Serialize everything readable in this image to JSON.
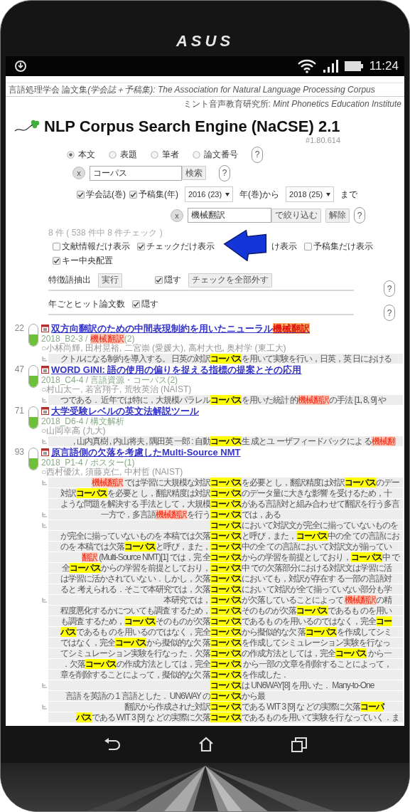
{
  "phone": {
    "brand": "ASUS"
  },
  "status_bar": {
    "time": "11:24"
  },
  "header": {
    "site_name": "言語処理学会 論文集",
    "site_subtitle": "(学会誌＋予稿集): The Association for Natural Language Processing Corpus",
    "institute_line": "ミント音声教育研究所: *Mint Phonetics Education Institute*",
    "title": "NLP Corpus Search Engine (NaCSE) 2.1",
    "version": "#1.80.614"
  },
  "search": {
    "fields": [
      {
        "label": "本文",
        "selected": true
      },
      {
        "label": "表題",
        "selected": false
      },
      {
        "label": "筆者",
        "selected": false
      },
      {
        "label": "論文番号",
        "selected": false
      }
    ],
    "fields_help": "?",
    "clear": "x",
    "query": "コーパス",
    "search_button": "検索",
    "query_help": "?"
  },
  "range": {
    "sources": [
      {
        "label": "学会誌(巻)",
        "checked": true
      },
      {
        "label": "予稿集(年)",
        "checked": true
      }
    ],
    "from": "2016 (23)",
    "from_suffix": "年(巻)から",
    "to": "2018 (25)",
    "to_suffix": "まで"
  },
  "filter": {
    "clear": "x",
    "value": "機械翻訳",
    "apply_button": "で絞り込む",
    "reset_button": "解除",
    "help": "?"
  },
  "count": "8 件 ( 538 件中 8 件チェック )",
  "options": [
    {
      "label": "文献情報だけ表示",
      "checked": false
    },
    {
      "label": "チェックだけ表示",
      "checked": true
    },
    {
      "label": "予稿集だけ表示",
      "checked": false
    },
    {
      "label": "キー中央配置",
      "checked": true
    }
  ],
  "covered_option_text": "け表示",
  "features": {
    "label": "特徴語抽出",
    "run_button": "実行",
    "hide": {
      "label": "隠す",
      "checked": true
    },
    "uncheck_button": "チェックを全部外す",
    "help": "?"
  },
  "yearly": {
    "label": "年ごとヒット論文数",
    "hide": {
      "label": "隠す",
      "checked": true
    },
    "help": "?"
  },
  "results": [
    {
      "rank": "22",
      "on": true,
      "title": [
        {
          "kind": "text",
          "text": "双方向翻訳のための中間表現制約を用いたニューラル"
        },
        {
          "kind": "mt",
          "text": "機械翻訳"
        }
      ],
      "meta": [
        {
          "kind": "text",
          "text": "2018_B2-3 / "
        },
        {
          "kind": "mt",
          "text": "機械翻訳"
        },
        {
          "kind": "text",
          "text": "(2)"
        }
      ],
      "authors": "○小林尚輝, 田村晃裕, 二宮崇 (愛媛大), 高村大也, 奥村学 (東工大)",
      "snippets": [
        {
          "lines": [
            {
              "left": [
                {
                  "kind": "text",
                  "text": "クトルになる制約を導入する。 日英の対訳"
                }
              ],
              "right": [
                {
                  "kind": "corpus",
                  "text": "コーパス"
                },
                {
                  "kind": "text",
                  "text": "を用いて実験を行い，日英，英 日における"
                }
              ]
            }
          ]
        }
      ]
    },
    {
      "rank": "47",
      "on": true,
      "title": [
        {
          "kind": "text",
          "text": "WORD GINI: 語の使用の偏りを捉える指標の提案とその応用"
        }
      ],
      "meta": [
        {
          "kind": "text",
          "text": "2018_C4-4 / 言語資源・コーパス(2)"
        }
      ],
      "authors": "○村山太一, 若宮翔子, 荒牧英治 (NAIST)",
      "snippets": [
        {
          "lines": [
            {
              "left": [
                {
                  "kind": "text",
                  "text": "つである． 近年では特に，大規模パラレル"
                }
              ],
              "right": [
                {
                  "kind": "corpus",
                  "text": "コーパス"
                },
                {
                  "kind": "text",
                  "text": "を用いた統計 的"
                },
                {
                  "kind": "mt",
                  "text": "機械翻訳"
                },
                {
                  "kind": "text",
                  "text": "の手法 [1, 8, 9] や"
                }
              ]
            }
          ]
        }
      ]
    },
    {
      "rank": "71",
      "on": true,
      "title": [
        {
          "kind": "text",
          "text": "大学受験レベルの英文法解説ツール"
        }
      ],
      "meta": [
        {
          "kind": "text",
          "text": "2018_D6-4 / 構文解析"
        }
      ],
      "authors": "○山岡幸高 (九大)",
      "snippets": [
        {
          "lines": [
            {
              "left": [
                {
                  "kind": "text",
                  "text": ", 山内真樹 , 内山将夫 , 隅田英 一郎 : 自動"
                }
              ],
              "right": [
                {
                  "kind": "corpus",
                  "text": "コーパス"
                },
                {
                  "kind": "text",
                  "text": "生 成とユ ーザフィードバックによ る"
                },
                {
                  "kind": "mt",
                  "text": "機械翻"
                }
              ]
            }
          ]
        }
      ]
    },
    {
      "rank": "93",
      "on": true,
      "title": [
        {
          "kind": "text",
          "text": "原言語側の欠落を考慮したMulti-Source NMT"
        }
      ],
      "meta": [
        {
          "kind": "text",
          "text": "2018_P1-4 / ポスター(1)"
        }
      ],
      "authors": "○西村優汰, 須藤克仁, 中村哲 (NAIST)",
      "snippets": [
        {
          "lines": [
            {
              "left": [
                {
                  "kind": "mt",
                  "text": "機械翻訳"
                },
                {
                  "kind": "text",
                  "text": " では学習に大規模な対訳"
                }
              ],
              "right": [
                {
                  "kind": "corpus",
                  "text": "コーパス"
                },
                {
                  "kind": "text",
                  "text": "を必要と し，翻訳精度は対訳"
                },
                {
                  "kind": "corpus",
                  "text": "コーパス"
                },
                {
                  "kind": "text",
                  "text": "のデー"
                }
              ]
            },
            {
              "left": [
                {
                  "kind": "text",
                  "text": "対訳"
                },
                {
                  "kind": "corpus",
                  "text": "コーパス"
                },
                {
                  "kind": "text",
                  "text": "を必要と し，翻訳精度は対訳"
                }
              ],
              "right": [
                {
                  "kind": "corpus",
                  "text": "コーパス"
                },
                {
                  "kind": "text",
                  "text": "のデータ量に大きな影響 を受けるため，十"
                }
              ]
            },
            {
              "left": [
                {
                  "kind": "text",
                  "text": "ような問題を解決する 手法として，大規模"
                }
              ],
              "right": [
                {
                  "kind": "corpus",
                  "text": "コーパス"
                },
                {
                  "kind": "text",
                  "text": "がある言語対と組み合わ せて翻訳を行う多言"
                }
              ]
            }
          ]
        },
        {
          "lines": [
            {
              "left": [
                {
                  "kind": "text",
                  "text": "一方で，多言語"
                },
                {
                  "kind": "mt",
                  "text": "機械翻訳"
                },
                {
                  "kind": "text",
                  "text": "を行う"
                }
              ],
              "right": [
                {
                  "kind": "corpus",
                  "text": "コーパス"
                },
                {
                  "kind": "text",
                  "text": "では，ある"
                }
              ]
            }
          ]
        },
        {
          "lines": [
            {
              "right": [
                {
                  "kind": "corpus",
                  "text": "コーパス"
                },
                {
                  "kind": "text",
                  "text": "において対訳文が完全に揃っていないものを"
                }
              ]
            },
            {
              "left": [
                {
                  "kind": "text",
                  "text": "が完全に揃っていないものを 本稿では欠落"
                }
              ],
              "right": [
                {
                  "kind": "corpus",
                  "text": "コーパス"
                },
                {
                  "kind": "text",
                  "text": "と呼び，また，"
                },
                {
                  "kind": "corpus",
                  "text": "コーパス"
                },
                {
                  "kind": "text",
                  "text": "中の全 ての言語にお"
                }
              ]
            },
            {
              "left": [
                {
                  "kind": "text",
                  "text": "のを 本稿では欠落"
                },
                {
                  "kind": "corpus",
                  "text": "コーパス"
                },
                {
                  "kind": "text",
                  "text": "と呼び，また，"
                }
              ],
              "right": [
                {
                  "kind": "corpus",
                  "text": "コーパス"
                },
                {
                  "kind": "text",
                  "text": "中の全 ての言語において対訳文が揃ってい"
                }
              ]
            },
            {
              "left": [
                {
                  "kind": "mt",
                  "text": "翻訳"
                },
                {
                  "kind": "text",
                  "text": " (Multi-Source NMT)[1] では，完 全"
                }
              ],
              "right": [
                {
                  "kind": "corpus",
                  "text": "コーパス"
                },
                {
                  "kind": "text",
                  "text": "からの学習を前提としており，"
                },
                {
                  "kind": "corpus",
                  "text": "コーパス"
                },
                {
                  "kind": "text",
                  "text": "中 で"
                }
              ]
            },
            {
              "left": [
                {
                  "kind": "text",
                  "text": "全"
                },
                {
                  "kind": "corpus",
                  "text": "コーパス"
                },
                {
                  "kind": "text",
                  "text": "からの学習を前提としており，"
                }
              ],
              "right": [
                {
                  "kind": "corpus",
                  "text": "コーパス"
                },
                {
                  "kind": "text",
                  "text": "中 での欠落部分における対訳文は学習に活"
                }
              ]
            },
            {
              "left": [
                {
                  "kind": "text",
                  "text": "は学習に活かされていな い．しかし，欠落"
                }
              ],
              "right": [
                {
                  "kind": "corpus",
                  "text": "コーパス"
                },
                {
                  "kind": "text",
                  "text": "においても，対訳が存在す る一部の言語対"
                }
              ]
            },
            {
              "left": [
                {
                  "kind": "text",
                  "text": "ると 考えられる．そこで本研究では，欠落"
                }
              ],
              "right": [
                {
                  "kind": "corpus",
                  "text": "コーパス"
                },
                {
                  "kind": "text",
                  "text": "におい て対訳が全て揃っていない部分も学"
                }
              ]
            }
          ]
        },
        {
          "lines": [
            {
              "left": [
                {
                  "kind": "text",
                  "text": "本研究では，"
                }
              ],
              "right": [
                {
                  "kind": "corpus",
                  "text": "コーパス"
                },
                {
                  "kind": "text",
                  "text": "が欠落していることによって "
                },
                {
                  "kind": "mt",
                  "text": "機械翻訳"
                },
                {
                  "kind": "text",
                  "text": "の精"
                }
              ]
            },
            {
              "left": [
                {
                  "kind": "text",
                  "text": "程度悪化するかについても調査 するため，"
                }
              ],
              "right": [
                {
                  "kind": "corpus",
                  "text": "コーパス"
                },
                {
                  "kind": "text",
                  "text": "そのものが欠落"
                },
                {
                  "kind": "corpus",
                  "text": "コーパス"
                },
                {
                  "kind": "text",
                  "text": "であるも のを用い"
                }
              ]
            },
            {
              "left": [
                {
                  "kind": "text",
                  "text": "も調査 するため，"
                },
                {
                  "kind": "corpus",
                  "text": "コーパス"
                },
                {
                  "kind": "text",
                  "text": "そのものが欠落"
                }
              ],
              "right": [
                {
                  "kind": "corpus",
                  "text": "コーパス"
                },
                {
                  "kind": "text",
                  "text": "であるも のを用いるのではなく，完全"
                },
                {
                  "kind": "corpus",
                  "text": "コー"
                }
              ]
            },
            {
              "left": [
                {
                  "kind": "corpus",
                  "text": "パス"
                },
                {
                  "kind": "text",
                  "text": "であるも のを用いるのではなく，完全"
                }
              ],
              "right": [
                {
                  "kind": "corpus",
                  "text": "コーパス"
                },
                {
                  "kind": "text",
                  "text": "から擬似的な欠 落"
                },
                {
                  "kind": "corpus",
                  "text": "コーパス"
                },
                {
                  "kind": "text",
                  "text": "を作成してシミ"
                }
              ]
            },
            {
              "left": [
                {
                  "kind": "text",
                  "text": "ではなく，完全"
                },
                {
                  "kind": "corpus",
                  "text": "コーパス"
                },
                {
                  "kind": "text",
                  "text": "から擬似的な欠 落"
                }
              ],
              "right": [
                {
                  "kind": "corpus",
                  "text": "コーパス"
                },
                {
                  "kind": "text",
                  "text": "を作成してシミュレーション実験を行なっ"
                }
              ]
            },
            {
              "left": [
                {
                  "kind": "text",
                  "text": "てシミュレーション実験を行なっ た．欠落"
                }
              ],
              "right": [
                {
                  "kind": "corpus",
                  "text": "コーパス"
                },
                {
                  "kind": "text",
                  "text": "の作成方法としては，完全"
                },
                {
                  "kind": "corpus",
                  "text": "コーパス"
                },
                {
                  "kind": "text",
                  "text": " から一"
                }
              ]
            },
            {
              "left": [
                {
                  "kind": "text",
                  "text": "．欠落"
                },
                {
                  "kind": "corpus",
                  "text": "コーパス"
                },
                {
                  "kind": "text",
                  "text": "の作成方法としては，完全"
                }
              ],
              "right": [
                {
                  "kind": "corpus",
                  "text": "コーパス"
                },
                {
                  "kind": "text",
                  "text": " から一部の文章を削除することによって，"
                }
              ]
            },
            {
              "left": [
                {
                  "kind": "text",
                  "text": "章を削除することによって，擬似的な欠 落"
                }
              ],
              "right": [
                {
                  "kind": "corpus",
                  "text": "コーパス"
                },
                {
                  "kind": "text",
                  "text": "を作成した．"
                }
              ]
            }
          ]
        },
        {
          "lines": [
            {
              "right": [
                {
                  "kind": "corpus",
                  "text": "コーパス"
                },
                {
                  "kind": "text",
                  "text": "は UN6WAY[8] を用いた． Many-to-One"
                }
              ]
            },
            {
              "left": [
                {
                  "kind": "text",
                  "text": "言語 を英語の 1 言語とした． UN6WAY の"
                }
              ],
              "right": [
                {
                  "kind": "corpus",
                  "text": "コーパス"
                },
                {
                  "kind": "text",
                  "text": "から最"
                }
              ]
            }
          ]
        },
        {
          "lines": [
            {
              "left": [
                {
                  "kind": "text",
                  "text": "翻訳から作成された対訳"
                }
              ],
              "right": [
                {
                  "kind": "corpus",
                  "text": "コーパス"
                },
                {
                  "kind": "text",
                  "text": "である WIT 3 [9] な どの実際に欠落"
                },
                {
                  "kind": "corpus",
                  "text": "コーパ"
                }
              ]
            },
            {
              "left": [
                {
                  "kind": "corpus",
                  "text": "パス"
                },
                {
                  "kind": "text",
                  "text": "である WIT 3 [9] な どの実際に欠落"
                }
              ],
              "right": [
                {
                  "kind": "corpus",
                  "text": "コーパス"
                },
                {
                  "kind": "text",
                  "text": "であるものを用いて実験を行 なっていく．ま"
                }
              ]
            }
          ]
        }
      ]
    }
  ]
}
